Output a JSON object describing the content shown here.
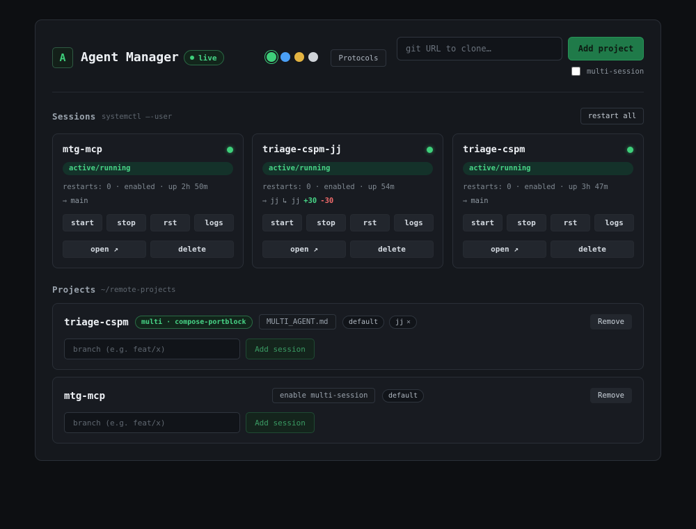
{
  "app": {
    "logo_letter": "A",
    "title": "Agent Manager",
    "live_label": "live"
  },
  "theme_swatches": [
    {
      "name": "green",
      "color": "#3ecf7a",
      "selected": true
    },
    {
      "name": "blue",
      "color": "#4a9ff5",
      "selected": false
    },
    {
      "name": "amber",
      "color": "#e3b341",
      "selected": false
    },
    {
      "name": "light-gray",
      "color": "#cfd3d8",
      "selected": false
    }
  ],
  "header": {
    "protocols_label": "Protocols",
    "git_placeholder": "git URL to clone…",
    "add_project_label": "Add project",
    "multi_session_label": "multi-session",
    "multi_session_checked": false
  },
  "sessions": {
    "title": "Sessions",
    "subtitle": "systemctl —-user",
    "restart_all_label": "restart all",
    "cards": [
      {
        "name": "mtg-mcp",
        "state": "active/running",
        "meta": "restarts: 0 · enabled · up 2h 50m",
        "branch_icon": "⇾",
        "branch": "main",
        "sub": "",
        "plus": "",
        "minus": ""
      },
      {
        "name": "triage-cspm-jj",
        "state": "active/running",
        "meta": "restarts: 0 · enabled · up 54m",
        "branch_icon": "⇾",
        "branch": "jj",
        "sub": "↳ jj",
        "plus": "+30",
        "minus": "-30"
      },
      {
        "name": "triage-cspm",
        "state": "active/running",
        "meta": "restarts: 0 · enabled · up 3h 47m",
        "branch_icon": "⇾",
        "branch": "main",
        "sub": "",
        "plus": "",
        "minus": ""
      }
    ],
    "buttons": {
      "start": "start",
      "stop": "stop",
      "rst": "rst",
      "logs": "logs",
      "open": "open ↗",
      "delete": "delete"
    }
  },
  "projects": {
    "title": "Projects",
    "subtitle": "~/remote-projects",
    "branch_placeholder": "branch (e.g. feat/x)",
    "add_session_label": "Add session",
    "remove_label": "Remove",
    "items": [
      {
        "name": "triage-cspm",
        "multi_tag": "multi · compose-portblock",
        "doc_chip": "MULTI_AGENT.md",
        "default_pill": "default",
        "session_pill": "jj",
        "session_pill_close": "×"
      },
      {
        "name": "mtg-mcp",
        "enable_chip": "enable multi-session",
        "default_pill": "default"
      }
    ]
  }
}
